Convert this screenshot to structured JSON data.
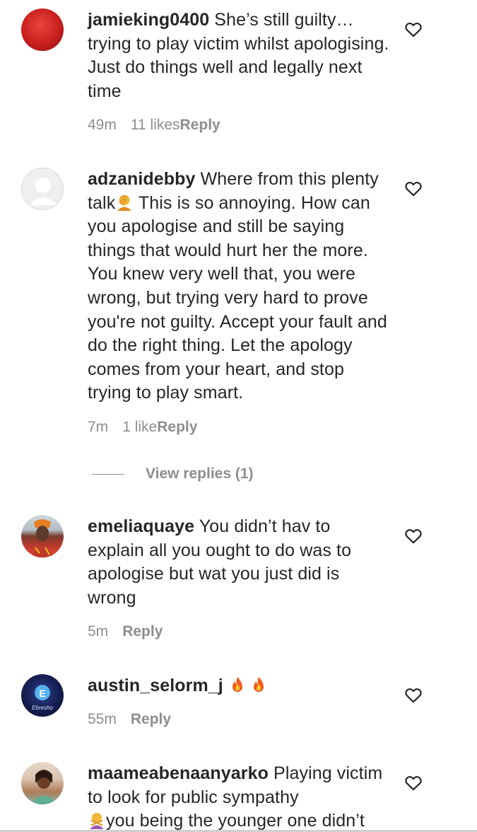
{
  "comments": [
    {
      "username": "jamieking0400",
      "text": " She’s still guilty… trying to play victim whilst apologising. Just do things well and legally next time",
      "time": "49m",
      "likes": "11 likes",
      "reply_label": "Reply"
    },
    {
      "username": "adzanidebby",
      "text_a": " Where from this plenty talk",
      "text_b": " This is so annoying. How can you apologise and still be saying things that would hurt her the more. You knew very well that, you were wrong, but trying very hard to prove you're not guilty. Accept your fault and do the right thing. Let the apology comes from your heart, and stop trying to play smart.",
      "time": "7m",
      "likes": "1 like",
      "reply_label": "Reply"
    },
    {
      "username": "emeliaquaye",
      "text": " You didn’t hav to explain all you ought to do was to apologise but wat you just did is wrong",
      "time": "5m",
      "reply_label": "Reply"
    },
    {
      "username": "austin_selorm_j",
      "time": "55m",
      "reply_label": "Reply",
      "avatar_text": "Ebresho"
    },
    {
      "username": "maameabenaanyarko",
      "text_a": " Playing victim to look for public sympathy",
      "text_b": "you being the younger one didn’t"
    }
  ],
  "view_replies": {
    "label": "View replies (1)"
  },
  "colors": {
    "text": "#262626",
    "muted": "#8e8e8e",
    "background": "#ffffff"
  },
  "icons": [
    "heart-outline-icon",
    "facepalm-emoji",
    "fire-emoji",
    "default-avatar-icon"
  ]
}
